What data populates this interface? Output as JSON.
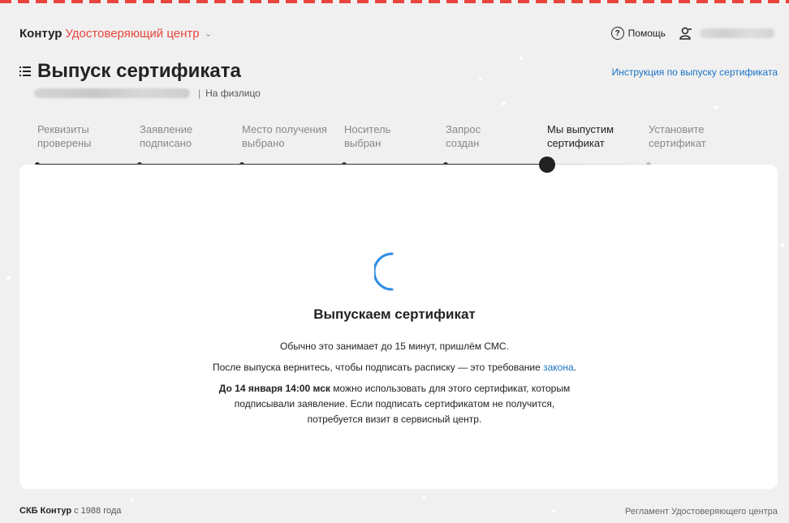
{
  "header": {
    "brand_kontur": "Контур",
    "brand_product": "Удостоверяющий центр",
    "help_label": "Помощь"
  },
  "page": {
    "title": "Выпуск сертификата",
    "person_type": "На физлицо",
    "instruction_link": "Инструкция по выпуску сертификата"
  },
  "steps": [
    {
      "line1": "Реквизиты",
      "line2": "проверены",
      "done": true
    },
    {
      "line1": "Заявление",
      "line2": "подписано",
      "done": true
    },
    {
      "line1": "Место получения",
      "line2": "выбрано",
      "done": true
    },
    {
      "line1": "Носитель",
      "line2": "выбран",
      "done": true
    },
    {
      "line1": "Запрос",
      "line2": "создан",
      "done": true
    },
    {
      "line1": "Мы выпустим",
      "line2": "сертификат",
      "active": true
    },
    {
      "line1": "Установите",
      "line2": "сертификат",
      "done": false
    }
  ],
  "status": {
    "title": "Выпускаем сертификат",
    "line1": "Обычно это занимает до 15 минут, пришлём СМС.",
    "line2_text": "После выпуска вернитесь, чтобы подписать расписку — это требование ",
    "line2_link": "закона",
    "line2_end": ".",
    "deadline_bold": "До 14 января 14:00 мск",
    "deadline_text": " можно использовать для этого сертификат, которым",
    "line4": "подписывали заявление. Если подписать сертификатом не получится,",
    "line5": "потребуется визит в сервисный центр."
  },
  "footer": {
    "company": "СКБ Контур",
    "since": " с 1988 года",
    "regulation_link": "Регламент Удостоверяющего центра"
  },
  "colors": {
    "accent_red": "#e8453c",
    "link_blue": "#1a73c5",
    "spinner_blue": "#2f8de4"
  }
}
